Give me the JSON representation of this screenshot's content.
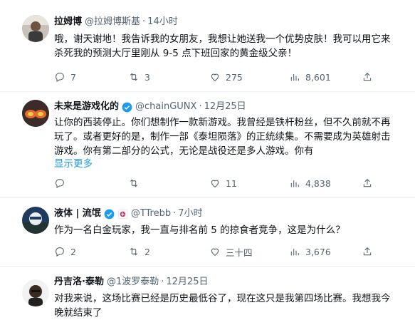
{
  "tweets": [
    {
      "name": "拉姆博",
      "handle": "@拉姆博斯基",
      "time": "14小时",
      "text": "哦，谢天谢地！我告诉我的女朋友，我想让她送我一个优势皮肤！我可以用它来杀死我的预测大厅里刚从 9-5 点下班回家的黄金级父亲！",
      "reply": "7",
      "retweet": "3",
      "like": "275",
      "views": "8,601",
      "verified": false
    },
    {
      "name": "未来是游戏化的",
      "handle": "@chainGUNX",
      "time": "12月25日",
      "text": "让你的西装停止。你们想制作一款新游戏。我曾经是铁杆粉丝，但不久前就不再玩了。或者更好的是，制作一部《泰坦陨落》的正统续集。不需要成为英雄射击游戏。你有第二部分的公式，无论是战役还是多人游戏。你有",
      "more": "显示更多",
      "reply": "",
      "retweet": "",
      "like": "11",
      "views": "4,838",
      "verified": true
    },
    {
      "name": "液体 | 流氓",
      "handle": "@TTrebb",
      "time": "7小时",
      "text": "作为一名白金玩家，我一直与排名前 5 的掠食者竞争，这是为什么？",
      "reply": "2",
      "retweet": "2",
      "like": "三十四",
      "views": "3,676",
      "verified": true,
      "badge": true
    },
    {
      "name": "丹吉洛·泰勒",
      "handle": "@1波罗泰勒",
      "time": "12月25日",
      "text": "对我来说，这场比赛已经是历史最低谷了，现在这只是我第四场比赛。我想我今晚就结束了",
      "verified": false
    }
  ],
  "colors": {
    "accent": "#1d9bf0",
    "muted": "#536471",
    "text": "#0f1419"
  }
}
